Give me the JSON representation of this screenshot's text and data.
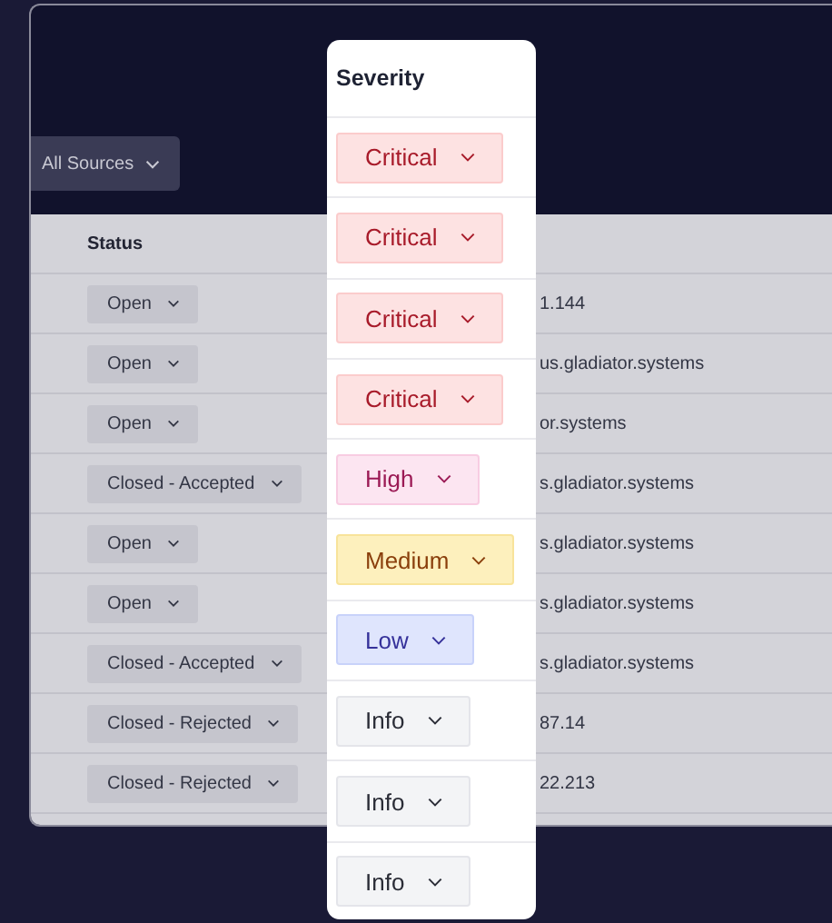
{
  "filter": {
    "label": "All Sources"
  },
  "table": {
    "columns": [
      "Status"
    ],
    "rows": [
      {
        "status": "Open",
        "column_2": "1.144"
      },
      {
        "status": "Open",
        "column_2": "us.gladiator.systems"
      },
      {
        "status": "Open",
        "column_2": "or.systems"
      },
      {
        "status": "Closed - Accepted",
        "column_2": "s.gladiator.systems"
      },
      {
        "status": "Open",
        "column_2": "s.gladiator.systems"
      },
      {
        "status": "Open",
        "column_2": "s.gladiator.systems"
      },
      {
        "status": "Closed - Accepted",
        "column_2": "s.gladiator.systems"
      },
      {
        "status": "Closed - Rejected",
        "column_2": "87.14"
      },
      {
        "status": "Closed - Rejected",
        "column_2": "22.213"
      }
    ]
  },
  "severity_panel": {
    "title": "Severity",
    "items": [
      {
        "label": "Critical",
        "kind": "critical"
      },
      {
        "label": "Critical",
        "kind": "critical"
      },
      {
        "label": "Critical",
        "kind": "critical"
      },
      {
        "label": "Critical",
        "kind": "critical"
      },
      {
        "label": "High",
        "kind": "high"
      },
      {
        "label": "Medium",
        "kind": "medium"
      },
      {
        "label": "Low",
        "kind": "low"
      },
      {
        "label": "Info",
        "kind": "info"
      },
      {
        "label": "Info",
        "kind": "info"
      },
      {
        "label": "Info",
        "kind": "info"
      }
    ]
  }
}
